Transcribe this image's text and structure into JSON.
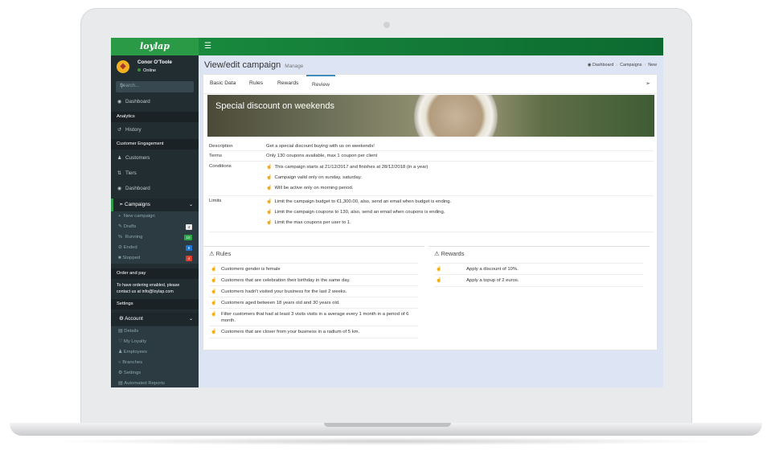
{
  "app": {
    "logo": "loylap",
    "menu_icon": "hamburger-icon"
  },
  "user": {
    "name": "Conor O'Toole",
    "status": "Online"
  },
  "search": {
    "placeholder": "Search..."
  },
  "sidebar": {
    "dashboard": "Dashboard",
    "analytics": "Analytics",
    "history": "History",
    "customer_engagement": "Customer Engagement",
    "customers": "Customers",
    "tiers": "Tiers",
    "dashboard2": "Dashboard",
    "campaigns": "Campaigns",
    "campaign_items": [
      {
        "label": "New campaign",
        "badge": "",
        "badge_color": ""
      },
      {
        "label": "Drafts",
        "badge": "4",
        "badge_color": "#e8e8e8"
      },
      {
        "label": "Running",
        "badge": "10",
        "badge_color": "#28a745"
      },
      {
        "label": "Ended",
        "badge": "8",
        "badge_color": "#1f76d2"
      },
      {
        "label": "Stopped",
        "badge": "4",
        "badge_color": "#dd3f2e"
      }
    ],
    "order_and_pay": "Order and pay",
    "ordering_note": "To have ordering enabled, please contact us at info@loylap.com",
    "settings_head": "Settings",
    "account": "Account",
    "account_items": [
      "Details",
      "My Loyalty",
      "Employees",
      "Branches",
      "Settings",
      "Automated Reports"
    ]
  },
  "page": {
    "title": "View/edit campaign",
    "subtitle": "Manage"
  },
  "breadcrumb": [
    "Dashboard",
    "Campaigns",
    "New"
  ],
  "tabs": [
    "Basic Data",
    "Rules",
    "Rewards",
    "Review"
  ],
  "active_tab": "Review",
  "campaign": {
    "title": "Special discount on weekends",
    "labels": {
      "description": "Description",
      "terms": "Terms",
      "conditions": "Conditions",
      "limits": "Limits"
    },
    "description": "Get a special discount buying with us on weekends!",
    "terms": "Only 130 coupons available, max 1 coupon per client",
    "conditions": [
      "This campaign starts at 21/12/2017 and finishes at 28/12/2018 (in a year)",
      "Campaign valid only on sunday, saturday.",
      "Will be active only on morning period."
    ],
    "limits": [
      "Limit the campaign budget to €1,300.00, also, send an email when budget is ending.",
      "Limit the campaign coupons to 130, also, send an email when coupons is ending.",
      "Limit the max coupons per user to 1."
    ]
  },
  "rules": {
    "title": "Rules",
    "items": [
      "Customers gender is female",
      "Customers that are celebration their birthday in the same day.",
      "Customers hadn't visited your business for the last 2 weeks.",
      "Customers aged between 18 years old and 30 years old.",
      "Filter customers that had at least 3 visits visits in a average every 1 month in a period of 6 month.",
      "Customers that are closer from your business in a radium of 5 km."
    ]
  },
  "rewards": {
    "title": "Rewards",
    "items": [
      "Apply a discount of 10%.",
      "Apply a topup of 2 euros."
    ]
  }
}
